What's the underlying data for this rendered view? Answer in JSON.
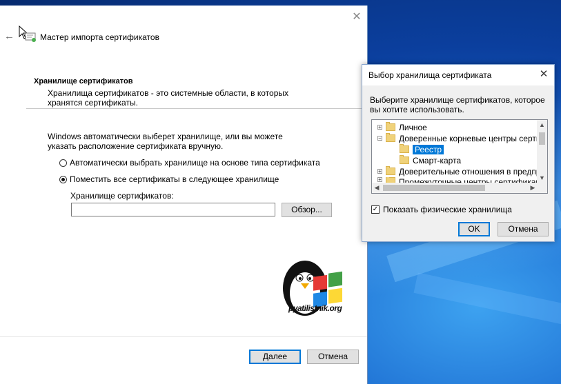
{
  "wizard": {
    "title": "Мастер импорта сертификатов",
    "close_glyph": "✕",
    "back_glyph": "←",
    "store_heading": "Хранилище сертификатов",
    "store_description": "Хранилища сертификатов - это системные области, в которых хранятся сертификаты.",
    "auto_select_text": "Windows автоматически выберет хранилище, или вы можете указать расположение сертификата вручную.",
    "radio_auto_label": "Автоматически выбрать хранилище на основе типа сертификата",
    "radio_manual_label": "Поместить все сертификаты в следующее хранилище",
    "radio_selected": "manual",
    "store_field_label": "Хранилище сертификатов:",
    "store_field_value": "",
    "browse_button": "Обзор...",
    "next_button": "Далее",
    "cancel_button": "Отмена",
    "logo_text": "pyatilistnik.org"
  },
  "store_dialog": {
    "title": "Выбор хранилища сертификата",
    "close_glyph": "✕",
    "description": "Выберите хранилище сертификатов, которое вы хотите использовать.",
    "tree": [
      {
        "label": "Личное",
        "level": 0,
        "expander": "+",
        "selected": false
      },
      {
        "label": "Доверенные корневые центры сертиф",
        "level": 0,
        "expander": "−",
        "selected": false
      },
      {
        "label": "Реестр",
        "level": 1,
        "expander": "",
        "selected": true
      },
      {
        "label": "Смарт-карта",
        "level": 1,
        "expander": "",
        "selected": false
      },
      {
        "label": "Доверительные отношения в предпри",
        "level": 0,
        "expander": "+",
        "selected": false
      },
      {
        "label": "Промежуточные центры сертификаци",
        "level": 0,
        "expander": "+",
        "selected": false
      }
    ],
    "show_physical_label": "Показать физические хранилища",
    "show_physical_checked": true,
    "ok_button": "OK",
    "cancel_button": "Отмена"
  },
  "colors": {
    "accent": "#0078d7",
    "button_face": "#e1e1e1",
    "folder": "#f0d27a"
  }
}
